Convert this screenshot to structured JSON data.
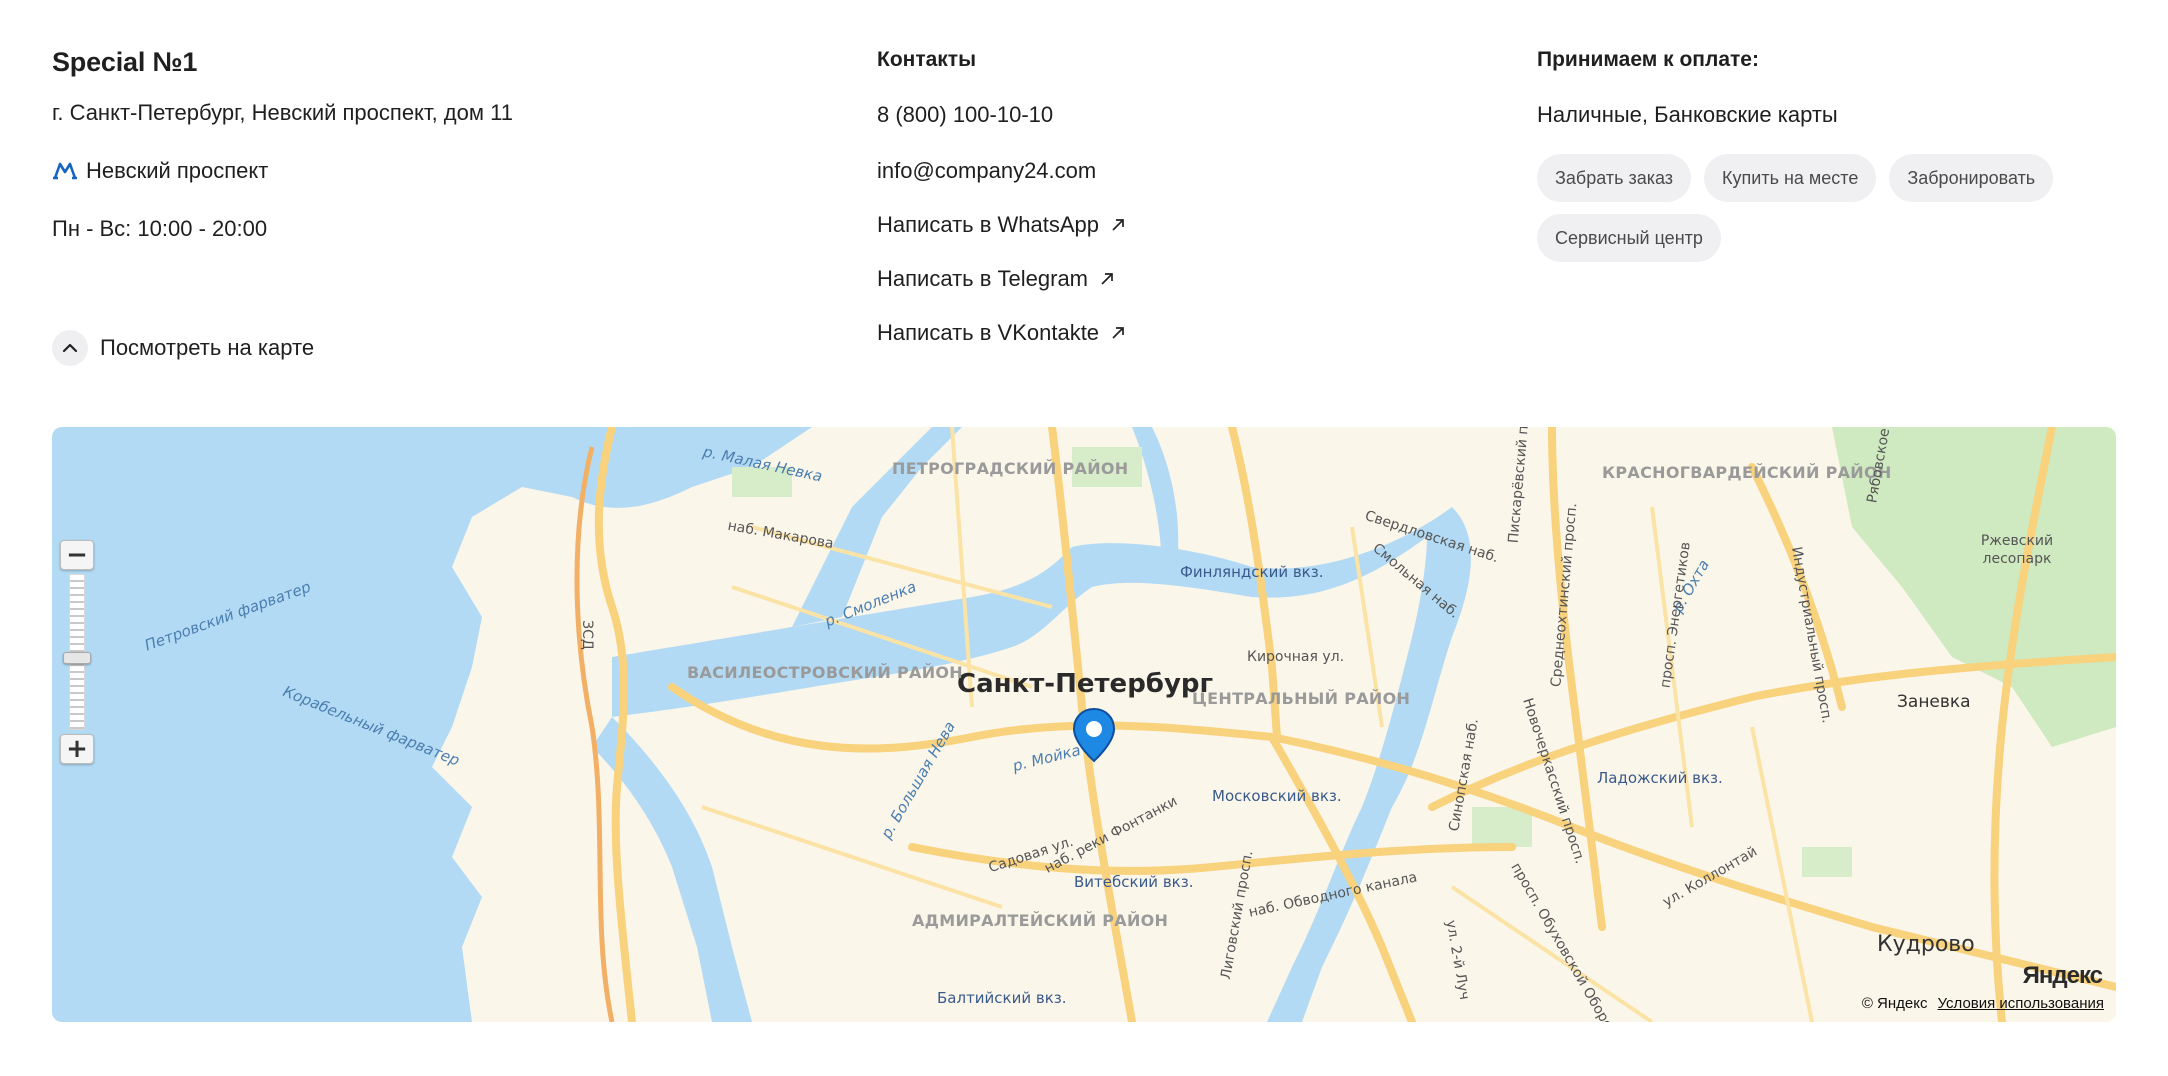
{
  "store": {
    "title": "Special №1",
    "address": "г. Санкт-Петербург, Невский проспект, дом 11",
    "metro_station": "Невский проспект",
    "hours": "Пн - Вс: 10:00 - 20:00",
    "map_toggle_label": "Посмотреть на карте"
  },
  "contacts": {
    "title": "Контакты",
    "phone": "8 (800) 100-10-10",
    "email": "info@company24.com",
    "messengers": [
      {
        "label": "Написать в WhatsApp"
      },
      {
        "label": "Написать в Telegram"
      },
      {
        "label": "Написать в VKontakte"
      }
    ]
  },
  "payment": {
    "title": "Принимаем к оплате:",
    "methods": "Наличные, Банковские карты",
    "services": [
      "Забрать заказ",
      "Купить на месте",
      "Забронировать",
      "Сервисный центр"
    ]
  },
  "map": {
    "city_label": "Санкт-Петербург",
    "districts": [
      "ПЕТРОГРАДСКИЙ РАЙОН",
      "ВАСИЛЕОСТРОВСКИЙ РАЙОН",
      "ЦЕНТРАЛЬНЫЙ РАЙОН",
      "КРАСНОГВАРДЕЙСКИЙ РАЙОН",
      "АДМИРАЛТЕЙСКИЙ РАЙОН"
    ],
    "water_labels": [
      "Петровский фарватер",
      "Корабельный фарватер",
      "р. Малая Невка",
      "р. Смоленка",
      "р. Большая Нева",
      "р. Мойка",
      "р. Охта"
    ],
    "stations": [
      "Финляндский вкз.",
      "Московский вкз.",
      "Ладожский вкз.",
      "Витебский вкз.",
      "Балтийский вкз."
    ],
    "streets": [
      "наб. Макарова",
      "Кирочная ул.",
      "Садовая ул.",
      "наб. реки Фонтанки",
      "наб. Обводного канала",
      "Лиговский просп.",
      "Синопская наб.",
      "Свердловская наб.",
      "Смольная наб.",
      "просп. Энергетиков",
      "Индустриальный просп.",
      "ул. Коллонтай",
      "Среднеохтинский просп.",
      "Новочеркасский просп.",
      "Пискарёвский просп.",
      "Рябовское ш.",
      "ул. 2-й Луч",
      "просп. Обуховской Обороны",
      "ЗСД"
    ],
    "places": [
      "Ржевский лесопарк",
      "Заневка",
      "Кудрово"
    ],
    "copyright": "© Яндекс",
    "terms": "Условия использования",
    "logo": "Яндекс",
    "colors": {
      "water": "#b3daf4",
      "land": "#fbf6ea",
      "roads_major": "#f8d27c",
      "park": "#cfe9c0",
      "marker": "#1e88e5"
    }
  }
}
